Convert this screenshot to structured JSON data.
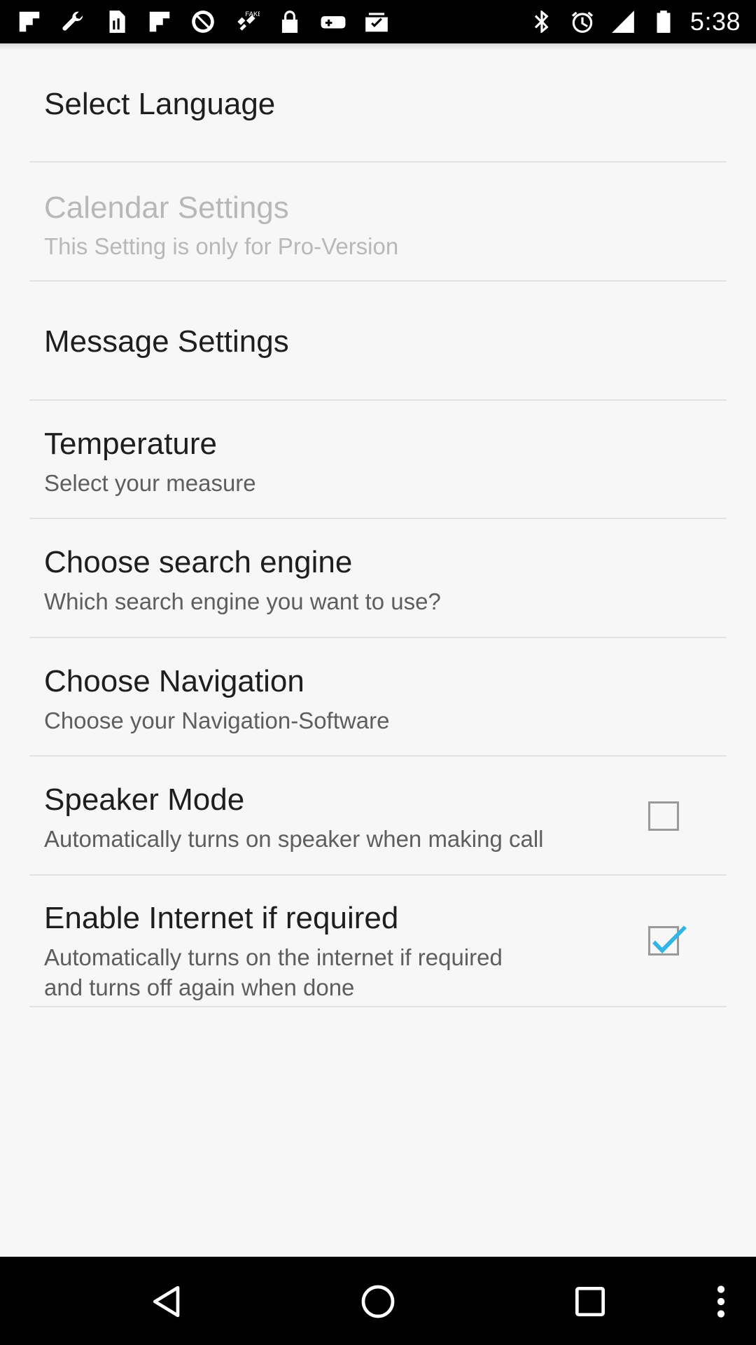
{
  "status_bar": {
    "time": "5:38",
    "left_icons": [
      "flipboard-icon",
      "wrench-icon",
      "sim-icon",
      "flipboard-icon",
      "block-icon",
      "fake-gps-icon",
      "lock-icon",
      "game-icon",
      "checklist-icon"
    ],
    "right_icons": [
      "bluetooth-icon",
      "alarm-icon",
      "signal-icon",
      "battery-icon"
    ]
  },
  "settings": [
    {
      "title": "Select Language",
      "summary": "",
      "enabled": true
    },
    {
      "title": "Calendar Settings",
      "summary": "This Setting is only for Pro-Version",
      "enabled": false
    },
    {
      "title": "Message Settings",
      "summary": "",
      "enabled": true
    },
    {
      "title": "Temperature",
      "summary": "Select your measure",
      "enabled": true
    },
    {
      "title": "Choose search engine",
      "summary": "Which search engine you want to use?",
      "enabled": true
    },
    {
      "title": "Choose Navigation",
      "summary": "Choose your Navigation-Software",
      "enabled": true
    },
    {
      "title": "Speaker Mode",
      "summary": "Automatically turns on speaker when making call",
      "enabled": true,
      "checked": false
    },
    {
      "title": "Enable Internet if required",
      "summary_line1": "Automatically turns on the internet if required",
      "summary_line2": "and turns off again when done",
      "enabled": true,
      "checked": true
    }
  ],
  "colors": {
    "check_accent": "#33b5e5",
    "background": "#f7f7f7",
    "bars": "#000000"
  },
  "nav_bar": [
    "back-icon",
    "home-icon",
    "recents-icon",
    "overflow-menu-icon"
  ]
}
